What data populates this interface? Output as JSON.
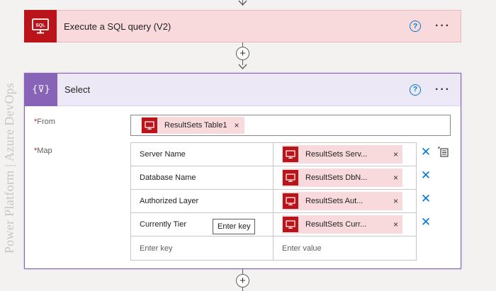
{
  "watermark": "Power Platform | Azure DevOps",
  "sql_action": {
    "title": "Execute a SQL query (V2)",
    "icon": "sql-database-icon",
    "help_glyph": "?",
    "more_glyph": "···"
  },
  "select_action": {
    "title": "Select",
    "icon": "data-operation-icon",
    "icon_glyph": "{⊽}",
    "help_glyph": "?",
    "more_glyph": "···",
    "from": {
      "required_mark": "*",
      "label": "From",
      "token": "ResultSets Table1"
    },
    "map": {
      "required_mark": "*",
      "label": "Map",
      "rows": [
        {
          "key": "Server Name",
          "value_token": "ResultSets Serv..."
        },
        {
          "key": "Database Name",
          "value_token": "ResultSets DbN..."
        },
        {
          "key": "Authorized Layer",
          "value_token": "ResultSets Aut..."
        },
        {
          "key": "Currently Tier",
          "value_token": "ResultSets Curr..."
        }
      ],
      "new_key_placeholder": "Enter key",
      "new_value_placeholder": "Enter value",
      "tooltip": "Enter key"
    }
  },
  "plus_glyph": "+",
  "remove_glyph": "×",
  "delete_glyph": "✕",
  "colors": {
    "sql_brand": "#ba141a",
    "select_brand": "#8764b8",
    "link_blue": "#0078d4"
  }
}
